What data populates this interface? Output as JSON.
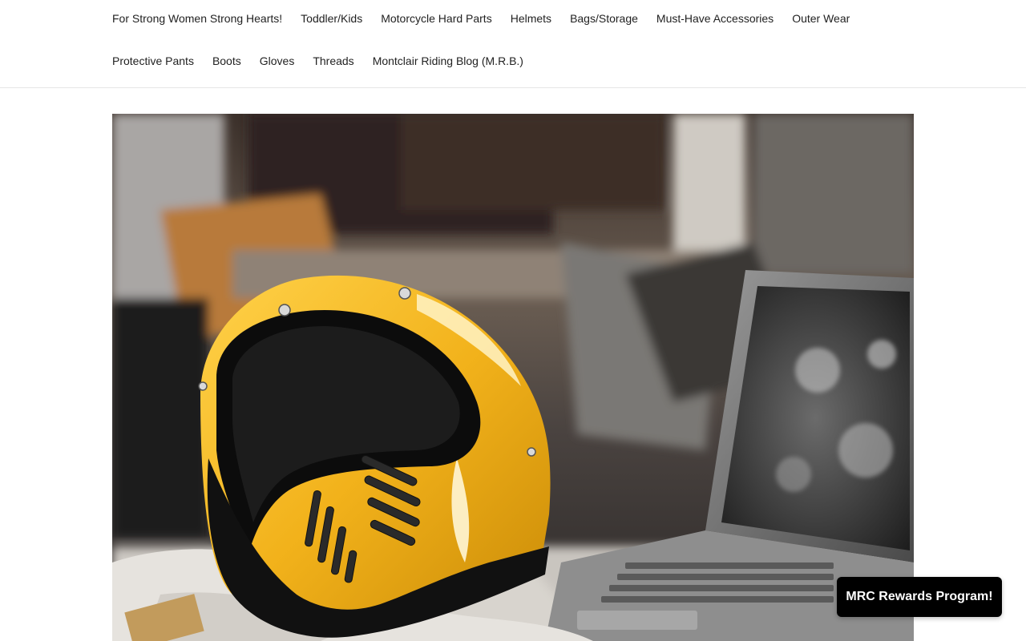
{
  "nav": {
    "row1": [
      {
        "label": "For Strong Women Strong Hearts!"
      },
      {
        "label": "Toddler/Kids"
      },
      {
        "label": "Motorcycle Hard Parts"
      },
      {
        "label": "Helmets"
      },
      {
        "label": "Bags/Storage"
      },
      {
        "label": "Must-Have Accessories"
      },
      {
        "label": "Outer Wear"
      }
    ],
    "row2": [
      {
        "label": "Protective Pants"
      },
      {
        "label": "Boots"
      },
      {
        "label": "Gloves"
      },
      {
        "label": "Threads"
      },
      {
        "label": "Montclair Riding Blog (M.R.B.)"
      }
    ]
  },
  "hero": {
    "helmet_color": "#f2b21b",
    "trim_color": "#111111"
  },
  "rewards": {
    "label": "MRC Rewards Program!"
  }
}
